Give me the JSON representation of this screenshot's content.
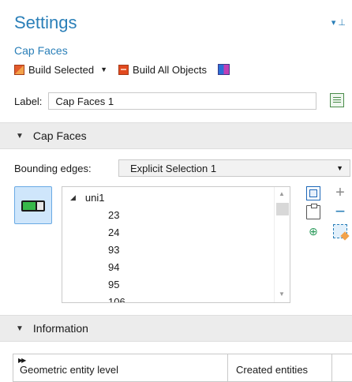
{
  "header": {
    "title": "Settings",
    "node_name": "Cap Faces",
    "pin_glyph": "▾ ⊥"
  },
  "toolbar": {
    "build_selected_label": "Build Selected",
    "build_all_label": "Build All Objects"
  },
  "label_field": {
    "label": "Label:",
    "value": "Cap Faces 1"
  },
  "cap_faces_section": {
    "title": "Cap Faces",
    "bounding_edges_label": "Bounding edges:",
    "bounding_edges_value": "Explicit Selection 1",
    "tree_root": "uni1",
    "items": [
      "23",
      "24",
      "93",
      "94",
      "95",
      "106"
    ]
  },
  "information_section": {
    "title": "Information",
    "columns": [
      "Geometric entity level",
      "Created entities"
    ]
  },
  "icons": {
    "pin": "pin-icon",
    "build_selected": "build-selected-icon",
    "build_all": "build-all-icon",
    "build_extra": "build-preview-icon",
    "edit_label": "edit-label-icon",
    "active_toggle": "active-toggle-icon",
    "copy": "copy-icon",
    "add": "add-icon",
    "paste": "paste-icon",
    "remove": "remove-icon",
    "zoom_selected": "zoom-selected-icon",
    "clear_selection": "clear-selection-icon"
  },
  "colors": {
    "accent": "#2a7fb8",
    "section_bg": "#ececec",
    "toggle_bg": "#cfe6fb"
  }
}
